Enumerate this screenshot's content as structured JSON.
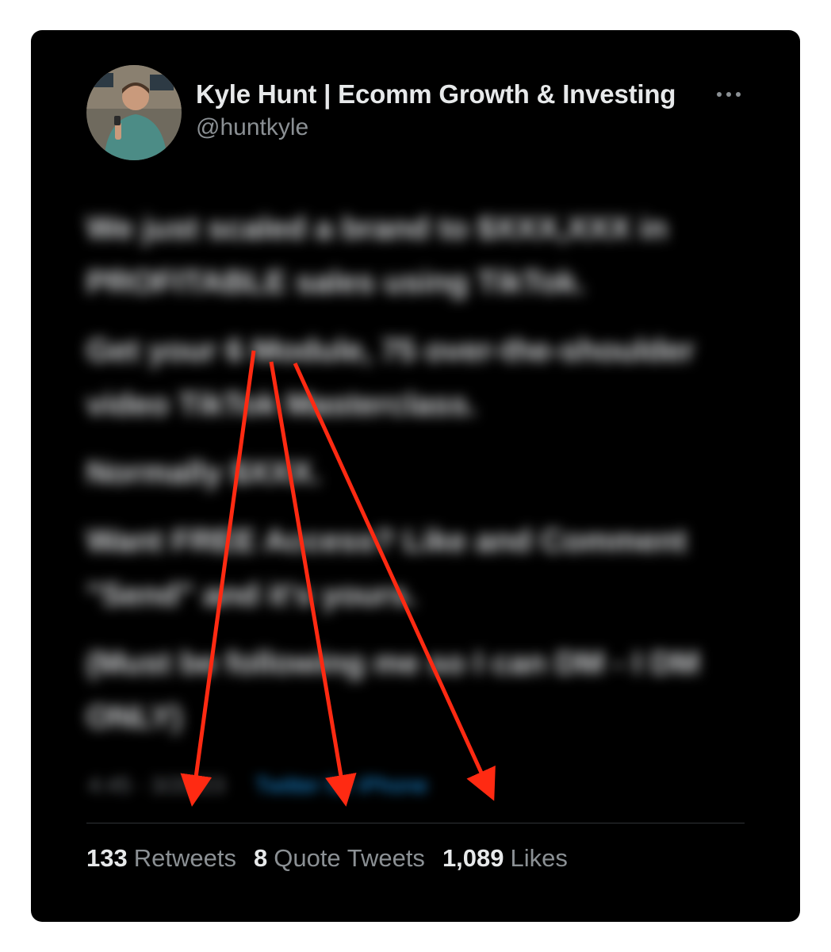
{
  "author": {
    "name": "Kyle Hunt | Ecomm Growth & Investing",
    "handle": "@huntkyle"
  },
  "tweet": {
    "paragraphs": [
      "We just scaled a brand to $XXX,XXX in PROFITABLE sales using TikTok.",
      "Get your 6 Module, 75 over-the-shoulder video TikTok Masterclass.",
      "Normally $XXX.",
      "Want FREE Access? Like and Comment \"Send\" and it's yours.",
      "(Must be following me so I can DM - I DM ONLY)"
    ],
    "timestamp": "4:45 · 3/20/23",
    "source": "Twitter for iPhone"
  },
  "stats": [
    {
      "count": "133",
      "label": "Retweets"
    },
    {
      "count": "8",
      "label": "Quote Tweets"
    },
    {
      "count": "1,089",
      "label": "Likes"
    }
  ],
  "annotation_color": "#ff2a12"
}
